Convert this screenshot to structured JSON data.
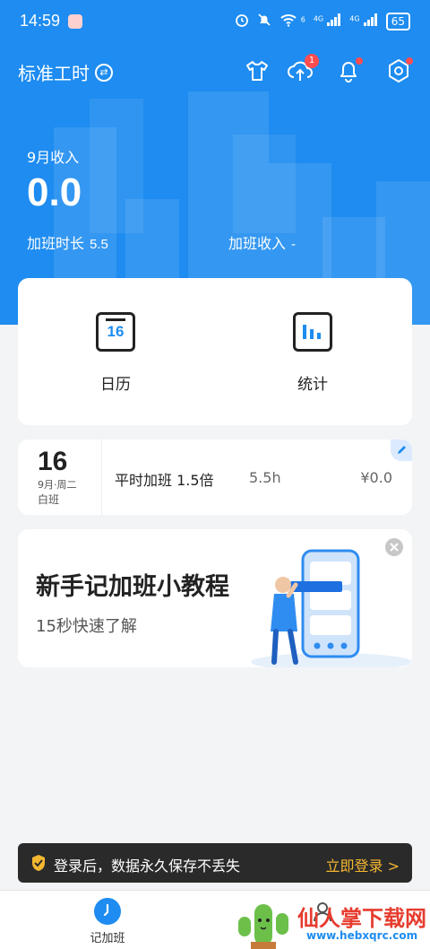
{
  "status_bar": {
    "time": "14:59",
    "signal_label_1": "4G",
    "signal_label_2": "4G",
    "wifi_label": "6",
    "battery": "65"
  },
  "header": {
    "mode_label": "标准工时",
    "upload_badge": "1"
  },
  "summary": {
    "month_income_label": "9月收入",
    "month_income_value": "0.0",
    "overtime_hours_label": "加班时长",
    "overtime_hours_value": "5.5",
    "overtime_income_label": "加班收入",
    "overtime_income_value": "-"
  },
  "quick_actions": {
    "calendar_label": "日历",
    "calendar_day": "16",
    "stats_label": "统计"
  },
  "record": {
    "day": "16",
    "week": "9月·周二",
    "shift": "白班",
    "type": "平时加班 1.5倍",
    "hours": "5.5h",
    "money": "¥0.0"
  },
  "tutorial": {
    "title": "新手记加班小教程",
    "subtitle": "15秒快速了解"
  },
  "login_banner": {
    "text": "登录后，数据永久保存不丢失",
    "link": "立即登录 >"
  },
  "tabbar": {
    "tab1_label": "记加班"
  },
  "watermark": {
    "text": "仙人掌下载网",
    "url": "www.hebxqrc.com"
  },
  "colors": {
    "brand": "#1e8cf0",
    "badge": "#ff4d4f",
    "login_link": "#f5b731"
  }
}
